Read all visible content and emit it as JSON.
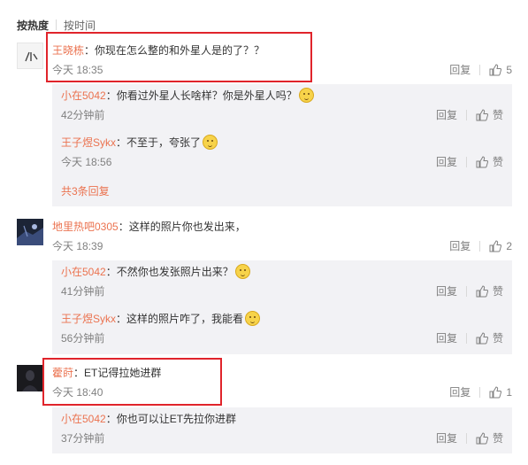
{
  "sort": {
    "hot": "按热度",
    "time": "按时间"
  },
  "comments": [
    {
      "user": "王晓栋",
      "text": "：你现在怎么整的和外星人是的了？？",
      "time": "今天 18:35",
      "reply": "回复",
      "likes": "5",
      "replies": [
        {
          "user": "小在5042",
          "text": "：你看过外星人长啥样？你是外星人吗？",
          "time": "42分钟前",
          "reply": "回复",
          "like": "赞"
        },
        {
          "user": "王子煜Sykx",
          "text": "：不至于，夸张了",
          "time": "今天 18:56",
          "reply": "回复",
          "like": "赞"
        }
      ],
      "more": "共3条回复"
    },
    {
      "user": "地里热吧0305",
      "text": "：这样的照片你也发出来，",
      "time": "今天 18:39",
      "reply": "回复",
      "likes": "2",
      "replies": [
        {
          "user": "小在5042",
          "text": "：不然你也发张照片出来？",
          "time": "41分钟前",
          "reply": "回复",
          "like": "赞"
        },
        {
          "user": "王子煜Sykx",
          "text": "：这样的照片咋了，我能看",
          "time": "56分钟前",
          "reply": "回复",
          "like": "赞"
        }
      ]
    },
    {
      "user": "藿莳",
      "text": "：ET记得拉她进群",
      "time": "今天 18:40",
      "reply": "回复",
      "likes": "1",
      "replies": [
        {
          "user": "小在5042",
          "text": "：你也可以让ET先拉你进群",
          "time": "37分钟前",
          "reply": "回复",
          "like": "赞"
        }
      ]
    }
  ],
  "colors": {
    "username": "#eb7350",
    "highlight": "#e0242b",
    "reply_bg": "#f2f2f5"
  }
}
